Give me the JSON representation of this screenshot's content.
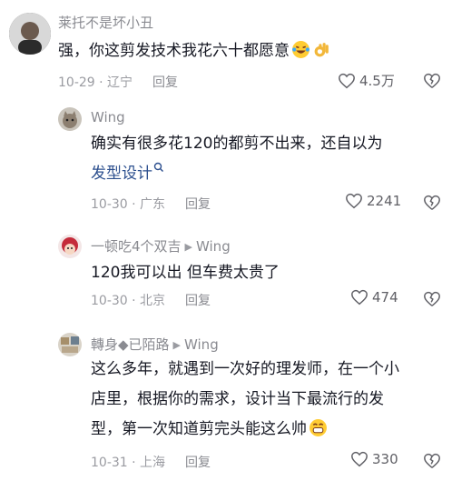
{
  "comments": [
    {
      "username": "莱托不是坏小丑",
      "text": "强，你这剪发技术我花六十都愿意",
      "date": "10-29",
      "location": "辽宁",
      "reply_label": "回复",
      "likes": "4.5万",
      "emojis": [
        "laughing-face-icon",
        "ok-hand-icon"
      ]
    },
    {
      "username": "Wing",
      "text": "确实有很多花120的都剪不出来，还自以为",
      "link_text": "发型设计",
      "date": "10-30",
      "location": "广东",
      "reply_label": "回复",
      "likes": "2241"
    },
    {
      "username": "一顿吃4个双吉",
      "reply_to": "Wing",
      "text": "120我可以出 但车费太贵了",
      "date": "10-30",
      "location": "北京",
      "reply_label": "回复",
      "likes": "474"
    },
    {
      "username": "轉身◆已陌路",
      "reply_to": "Wing",
      "text_lines": [
        "这么多年，就遇到一次好的理发师，在一个小",
        "店里，根据你的需求，设计当下最流行的发",
        "型，第一次知道剪完头能这么帅"
      ],
      "date": "10-31",
      "location": "上海",
      "reply_label": "回复",
      "likes": "330",
      "emojis": [
        "grinning-face-icon"
      ]
    }
  ],
  "separator": " · ",
  "colors": {
    "name": "#8a8b91",
    "text": "#161823",
    "meta": "#9a9ba1",
    "link": "#2c4f8e"
  }
}
